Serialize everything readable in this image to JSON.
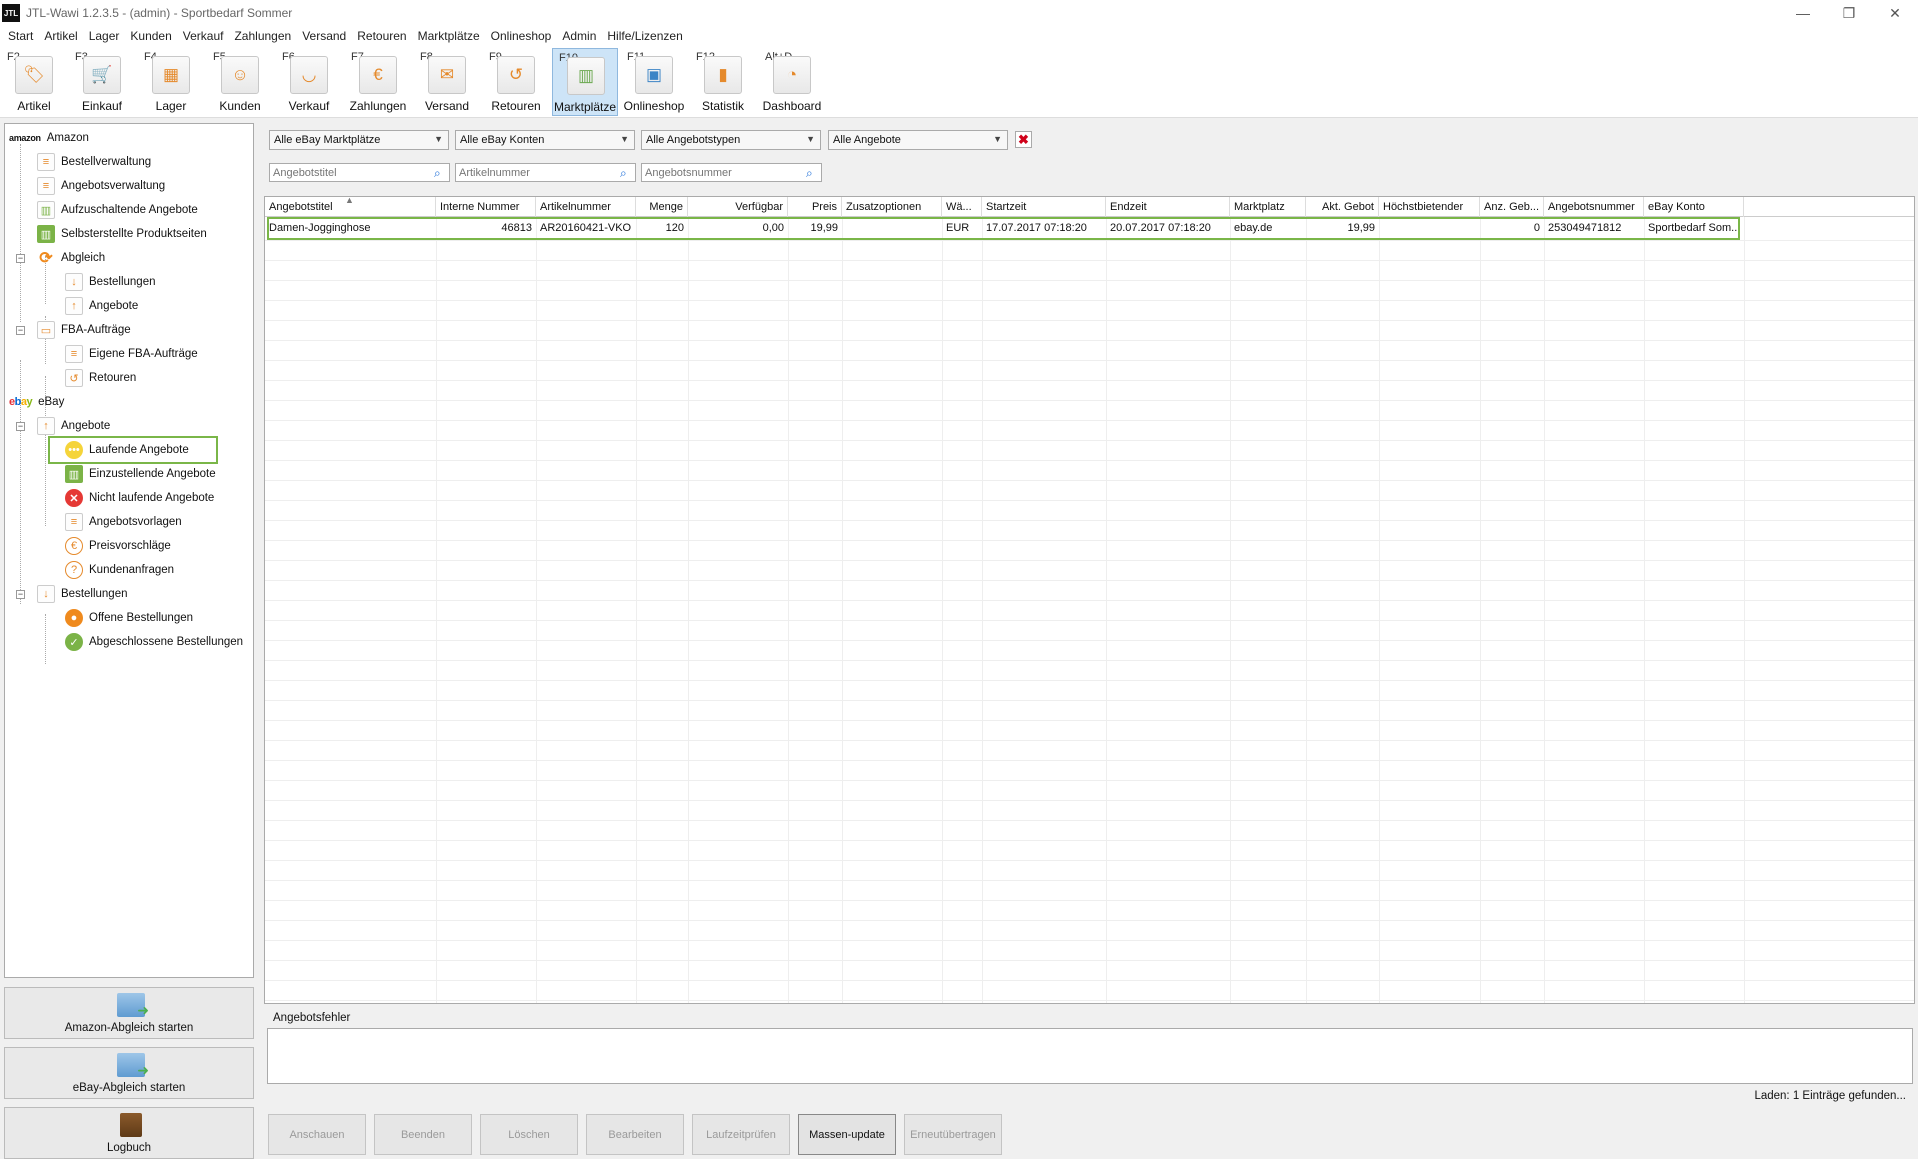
{
  "window": {
    "logo": "JTL",
    "title": "JTL-Wawi 1.2.3.5 - (admin) - Sportbedarf Sommer",
    "minimize": "—",
    "restore": "❐",
    "close": "✕"
  },
  "menu": [
    "Start",
    "Artikel",
    "Lager",
    "Kunden",
    "Verkauf",
    "Zahlungen",
    "Versand",
    "Retouren",
    "Marktplätze",
    "Onlineshop",
    "Admin",
    "Hilfe/Lizenzen"
  ],
  "toolbar": [
    {
      "key": "F2",
      "label": "Artikel",
      "icon": "tag-icon",
      "glyph": "🏷"
    },
    {
      "key": "F3",
      "label": "Einkauf",
      "icon": "cart-icon",
      "glyph": "🛒"
    },
    {
      "key": "F4",
      "label": "Lager",
      "icon": "warehouse-icon",
      "glyph": "▦"
    },
    {
      "key": "F5",
      "label": "Kunden",
      "icon": "customer-icon",
      "glyph": "☺"
    },
    {
      "key": "F6",
      "label": "Verkauf",
      "icon": "sales-icon",
      "glyph": "◡"
    },
    {
      "key": "F7",
      "label": "Zahlungen",
      "icon": "euro-icon",
      "glyph": "€"
    },
    {
      "key": "F8",
      "label": "Versand",
      "icon": "shipping-icon",
      "glyph": "✉"
    },
    {
      "key": "F9",
      "label": "Retouren",
      "icon": "returns-icon",
      "glyph": "↺"
    },
    {
      "key": "F10",
      "label": "Marktplätze",
      "icon": "marketplace-icon",
      "glyph": "▥",
      "active": true
    },
    {
      "key": "F11",
      "label": "Onlineshop",
      "icon": "onlineshop-icon",
      "glyph": "▣"
    },
    {
      "key": "F12",
      "label": "Statistik",
      "icon": "statistics-icon",
      "glyph": "▮"
    },
    {
      "key": "Alt+D",
      "label": "Dashboard",
      "icon": "dashboard-icon",
      "glyph": "◔"
    }
  ],
  "tree": {
    "amazon": {
      "logo": "amazon",
      "label": "Amazon",
      "items": {
        "bestellverwaltung": "Bestellverwaltung",
        "angebotsverwaltung": "Angebotsverwaltung",
        "aufzuschaltende": "Aufzuschaltende Angebote",
        "selbsterstellte": "Selbsterstellte Produktseiten",
        "abgleich": "Abgleich",
        "abgleich_bestellungen": "Bestellungen",
        "abgleich_angebote": "Angebote",
        "fba": "FBA-Aufträge",
        "fba_eigene": "Eigene FBA-Aufträge",
        "fba_retouren": "Retouren"
      }
    },
    "ebay": {
      "logo_e": "e",
      "logo_b": "b",
      "logo_a": "a",
      "logo_y": "y",
      "label": "eBay",
      "items": {
        "angebote": "Angebote",
        "laufende": "Laufende Angebote",
        "einzustellende": "Einzustellende Angebote",
        "nicht_laufende": "Nicht laufende Angebote",
        "angebotsvorlagen": "Angebotsvorlagen",
        "preisvorschlaege": "Preisvorschläge",
        "kundenanfragen": "Kundenanfragen",
        "bestellungen": "Bestellungen",
        "offene": "Offene Bestellungen",
        "abgeschlossene": "Abgeschlossene Bestellungen"
      }
    }
  },
  "left_buttons": {
    "amazon_sync": "Amazon-Abgleich starten",
    "ebay_sync": "eBay-Abgleich starten",
    "logbuch": "Logbuch"
  },
  "filters": {
    "marketplaces": "Alle eBay Marktplätze",
    "accounts": "Alle eBay Konten",
    "offer_types": "Alle Angebotstypen",
    "offers": "Alle Angebote",
    "search_title": "Angebotstitel",
    "search_article": "Artikelnummer",
    "search_offer": "Angebotsnummer"
  },
  "grid": {
    "columns": [
      "Angebotstitel",
      "Interne Nummer",
      "Artikelnummer",
      "Menge",
      "Verfügbar",
      "Preis",
      "Zusatzoptionen",
      "Wä...",
      "Startzeit",
      "Endzeit",
      "Marktplatz",
      "Akt. Gebot",
      "Höchstbietender",
      "Anz. Geb...",
      "Angebotsnummer",
      "eBay Konto"
    ],
    "rows": [
      {
        "titel": "Damen-Jogginghose",
        "interne_nummer": "46813",
        "artikelnummer": "AR20160421-VKO",
        "menge": "120",
        "verfuegbar": "0,00",
        "preis": "19,99",
        "zusatzoptionen": "",
        "waehrung": "EUR",
        "startzeit": "17.07.2017 07:18:20",
        "endzeit": "20.07.2017 07:18:20",
        "marktplatz": "ebay.de",
        "akt_gebot": "19,99",
        "hoechstbietender": "",
        "anz_gebote": "0",
        "angebotsnummer": "253049471812",
        "ebay_konto": "Sportbedarf Som..."
      }
    ]
  },
  "error_panel": {
    "label": "Angebotsfehler"
  },
  "status": "Laden: 1 Einträge gefunden...",
  "actions": {
    "anschauen": "Anschauen",
    "beenden": "Beenden",
    "loeschen": "Löschen",
    "bearbeiten": "Bearbeiten",
    "laufzeit_1": "Laufzeit",
    "laufzeit_2": "prüfen",
    "massen_1": "Massen-",
    "massen_2": "update",
    "erneut_1": "Erneut",
    "erneut_2": "übertragen"
  }
}
